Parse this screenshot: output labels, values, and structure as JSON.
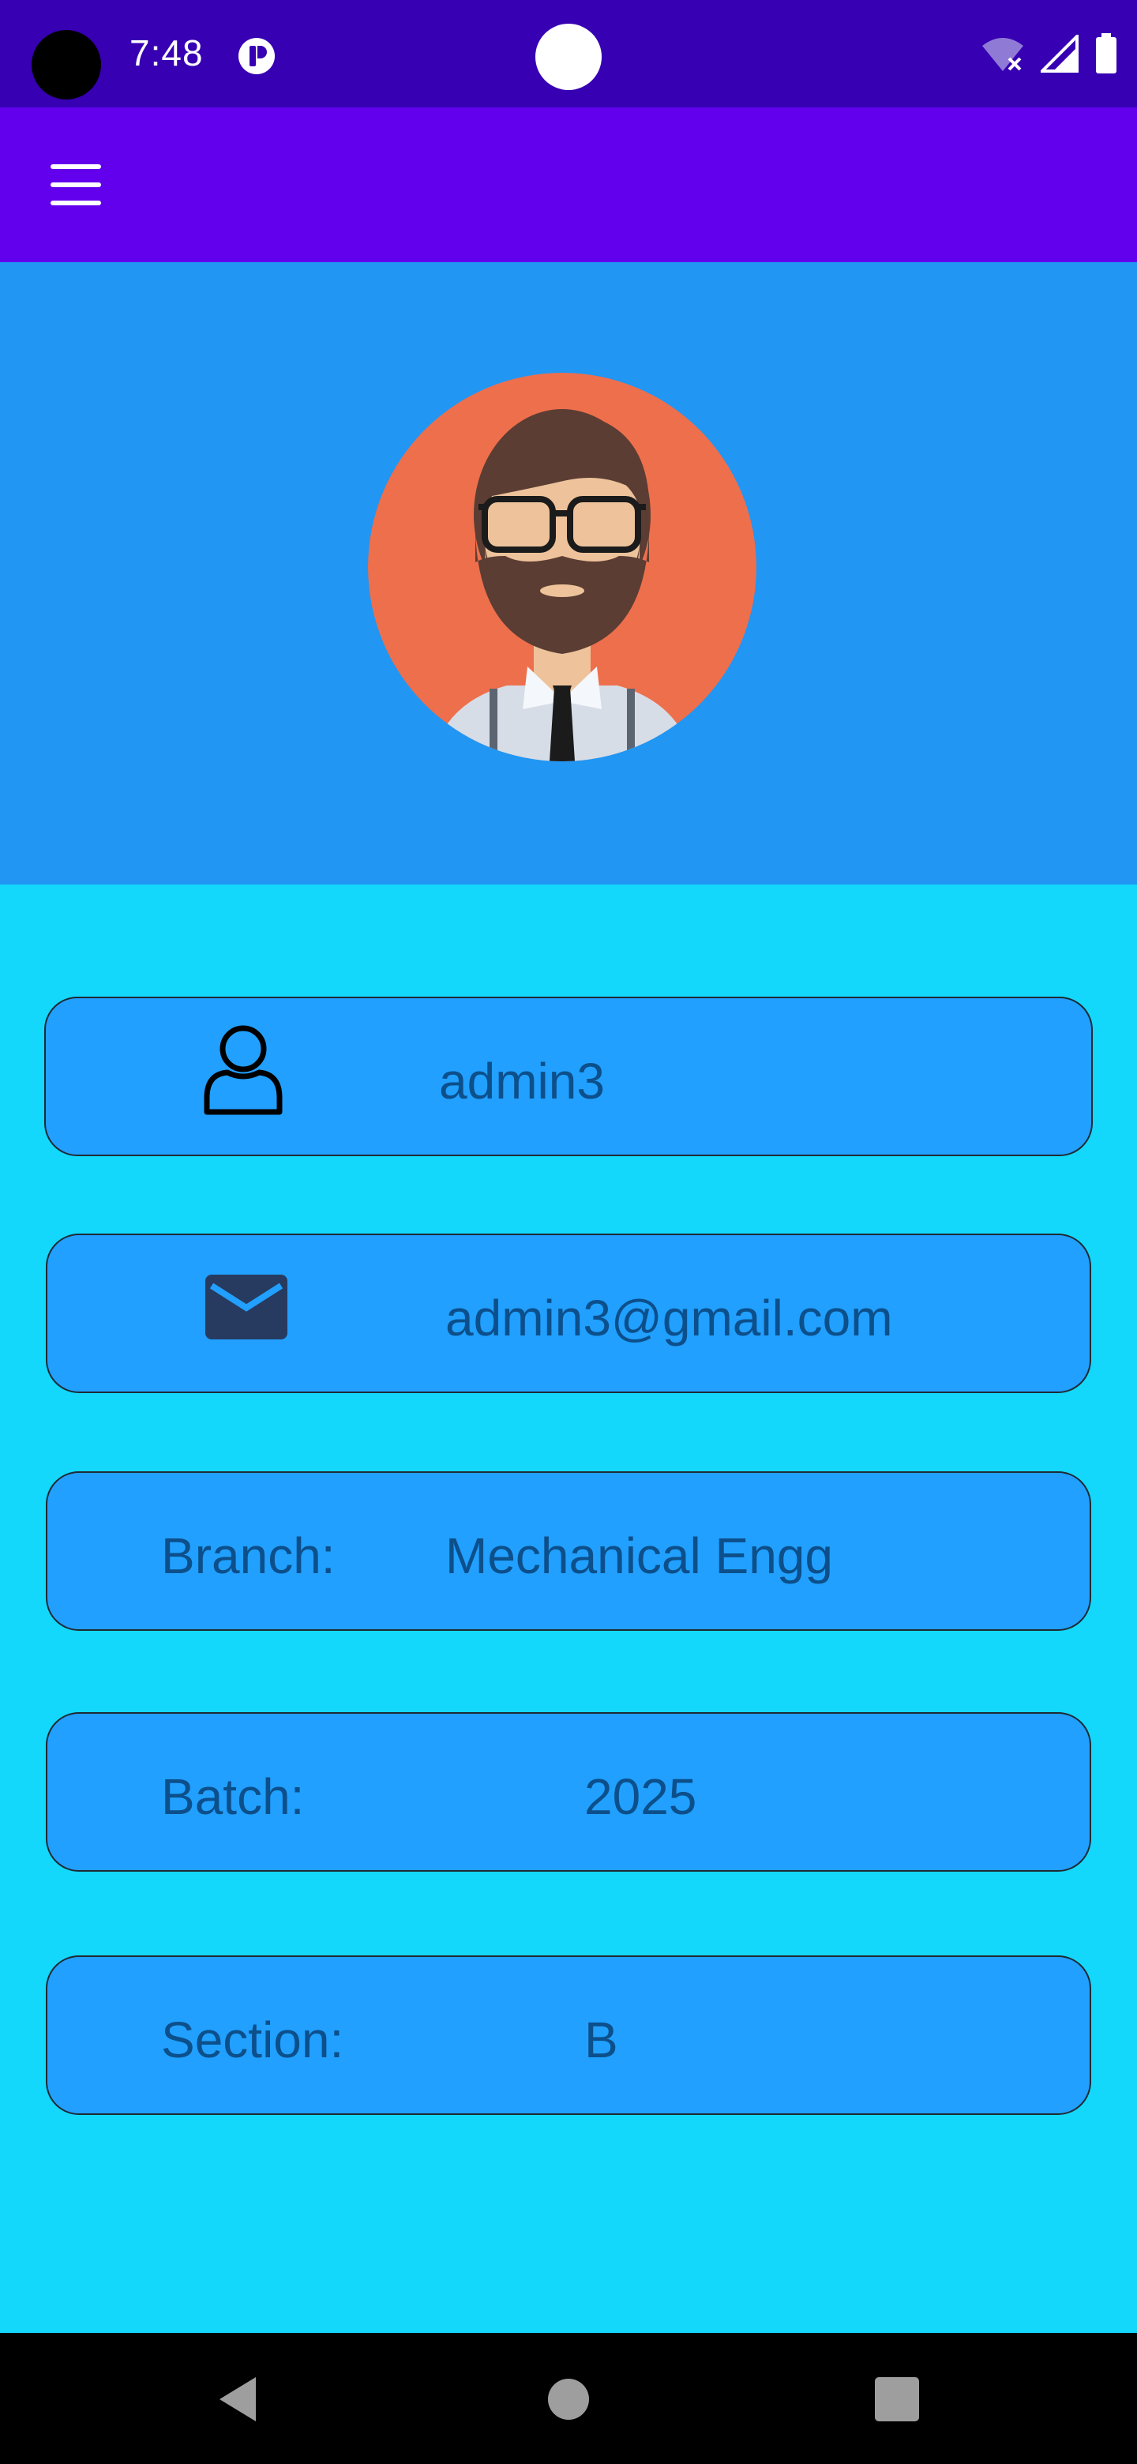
{
  "status_bar": {
    "time": "7:48"
  },
  "app_bar": {
    "menu_icon": "hamburger-menu-icon"
  },
  "profile": {
    "avatar_icon": "bearded-man-avatar",
    "username": "admin3",
    "email": "admin3@gmail.com",
    "branch_label": "Branch:",
    "branch_value": "Mechanical Engg",
    "batch_label": "Batch:",
    "batch_value": "2025",
    "section_label": "Section:",
    "section_value": "B"
  },
  "colors": {
    "status_bar": "#3700b3",
    "app_bar": "#6200ee",
    "header": "#2196f3",
    "background": "#13d8fc",
    "field": "#21a0ff",
    "field_text": "#0c4f8a"
  },
  "nav": {
    "back_icon": "back-triangle-icon",
    "home_icon": "home-circle-icon",
    "recents_icon": "recents-square-icon"
  }
}
